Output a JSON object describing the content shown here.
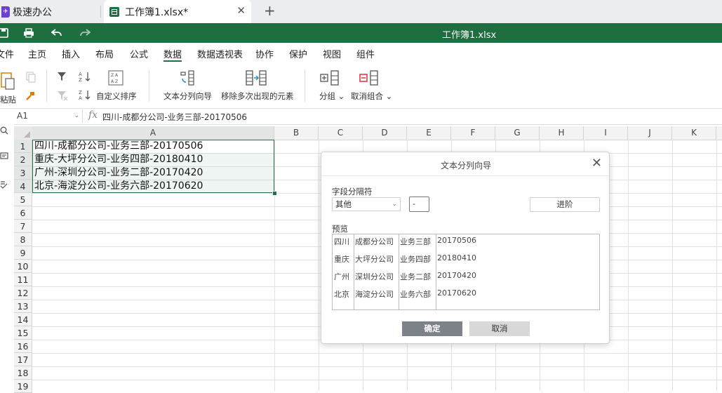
{
  "tabs": {
    "app_label": "极速办公",
    "doc_label": "工作簿1.xlsx*",
    "close_glyph": "✕",
    "add_glyph": "+"
  },
  "titlebar": {
    "doc_title": "工作簿1.xlsx"
  },
  "menu": [
    "文件",
    "主页",
    "插入",
    "布局",
    "公式",
    "数据",
    "数据透视表",
    "协作",
    "保护",
    "视图",
    "组件"
  ],
  "menu_active": "数据",
  "ribbon": {
    "paste": "粘贴",
    "custom_sort": "自定义排序",
    "text_to_columns": "文本分列向导",
    "remove_duplicates": "移除多次出现的元素",
    "group": "分组",
    "ungroup": "取消组合"
  },
  "formula_bar": {
    "cell_ref": "A1",
    "fx": "fx",
    "content": "四川-成都分公司-业务三部-20170506"
  },
  "grid": {
    "columns": [
      "A",
      "B",
      "C",
      "D",
      "E",
      "F",
      "G",
      "H",
      "I",
      "J",
      "K"
    ],
    "rows": [
      "1",
      "2",
      "3",
      "4",
      "5",
      "6",
      "7",
      "8",
      "9",
      "10",
      "11",
      "12",
      "13",
      "14",
      "15",
      "16",
      "17",
      "18",
      "19"
    ],
    "cells_A": [
      "四川-成都分公司-业务三部-20170506",
      "重庆-大坪分公司-业务四部-20180410",
      "广州-深圳分公司-业务二部-20170420",
      "北京-海淀分公司-业务六部-20170620"
    ]
  },
  "dialog": {
    "title": "文本分列向导",
    "delimiter_label": "字段分隔符",
    "delimiter_select": "其他",
    "delimiter_value": "-",
    "advanced": "进阶",
    "preview_label": "预览",
    "preview_rows": [
      [
        "四川",
        "成都分公司",
        "业务三部",
        "20170506"
      ],
      [
        "重庆",
        "大坪分公司",
        "业务四部",
        "20180410"
      ],
      [
        "广州",
        "深圳分公司",
        "业务二部",
        "20170420"
      ],
      [
        "北京",
        "海淀分公司",
        "业务六部",
        "20170620"
      ]
    ],
    "ok": "确定",
    "cancel": "取消"
  },
  "colors": {
    "green": "#1e6e40",
    "selection": "#217346",
    "ok_button": "#7d8288"
  }
}
